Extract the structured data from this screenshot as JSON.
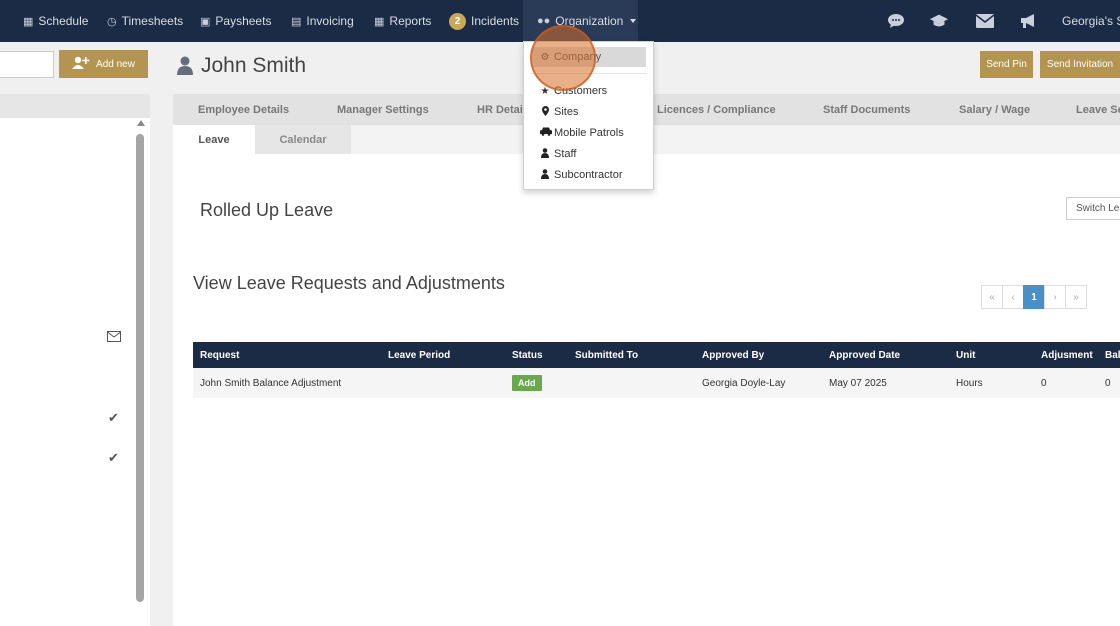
{
  "nav": {
    "items": [
      {
        "label": "Schedule",
        "icon": "calendar-icon"
      },
      {
        "label": "Timesheets",
        "icon": "clock-icon"
      },
      {
        "label": "Paysheets",
        "icon": "money-icon"
      },
      {
        "label": "Invoicing",
        "icon": "invoice-icon"
      },
      {
        "label": "Reports",
        "icon": "table-icon"
      },
      {
        "label": "Incidents",
        "badge": "2"
      },
      {
        "label": "Organization",
        "icon": "users-icon"
      }
    ],
    "right_icons": [
      "chat-icon",
      "graduation-cap-icon",
      "envelope-icon",
      "megaphone-icon"
    ],
    "user_label": "Georgia's Se"
  },
  "left": {
    "add_new_label": "Add new"
  },
  "header": {
    "title": "John Smith",
    "send_pin_label": "Send Pin",
    "send_invitation_label": "Send Invitation"
  },
  "tabs": [
    "Employee Details",
    "Manager Settings",
    "HR Detail",
    "Licences / Compliance",
    "Staff Documents",
    "Salary / Wage",
    "Leave Se"
  ],
  "subtabs": [
    "Leave",
    "Calendar"
  ],
  "sections": {
    "rolled_up": "Rolled Up Leave",
    "requests": "View Leave Requests and Adjustments",
    "switch_label": "Switch Lea"
  },
  "pager": {
    "first": "«",
    "prev": "‹",
    "current": "1",
    "next": "›",
    "last": "»"
  },
  "table": {
    "headers": [
      "Request",
      "Leave Period",
      "Status",
      "Submitted To",
      "Approved By",
      "Approved Date",
      "Unit",
      "Adjusment",
      "Bal"
    ],
    "rows": [
      {
        "request": "John Smith Balance Adjustment",
        "leave_period": "",
        "status": "Add",
        "submitted_to": "",
        "approved_by": "Georgia Doyle-Lay",
        "approved_date": "May 07 2025",
        "unit": "Hours",
        "adjustment": "0",
        "balance": "0"
      }
    ]
  },
  "dropdown": {
    "items": [
      {
        "label": "Company",
        "icon": "gear-icon"
      },
      {
        "label": "Customers",
        "icon": "star-icon"
      },
      {
        "label": "Sites",
        "icon": "map-marker-icon"
      },
      {
        "label": "Mobile Patrols",
        "icon": "car-icon"
      },
      {
        "label": "Staff",
        "icon": "user-icon"
      },
      {
        "label": "Subcontractor",
        "icon": "user-icon"
      }
    ]
  },
  "colors": {
    "nav_bg": "#1c2b45",
    "accent_gold": "#b39451",
    "badge": "#c9a85c",
    "status_green": "#6aa84f",
    "pager_active": "#4a90c8",
    "click_highlight": "#d66e28"
  }
}
